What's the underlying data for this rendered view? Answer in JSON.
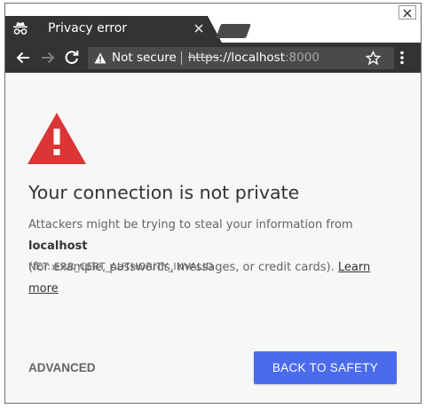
{
  "tab": {
    "title": "Privacy error"
  },
  "omnibox": {
    "security_label": "Not secure",
    "url_scheme": "https",
    "url_rest": "://localhost",
    "url_port": ":8000"
  },
  "page": {
    "heading": "Your connection is not private",
    "body_before_host": "Attackers might be trying to steal your information from",
    "host": "localhost",
    "body_after_host": "(for example, passwords, messages, or credit cards).",
    "learn_more": "Learn more",
    "error_code": "NET::ERR_CERT_AUTHORITY_INVALID"
  },
  "actions": {
    "advanced": "ADVANCED",
    "back_to_safety": "BACK TO SAFETY"
  },
  "colors": {
    "primary_button": "#4b6bed",
    "warning_red": "#db3535",
    "frame_dark": "#333333"
  }
}
